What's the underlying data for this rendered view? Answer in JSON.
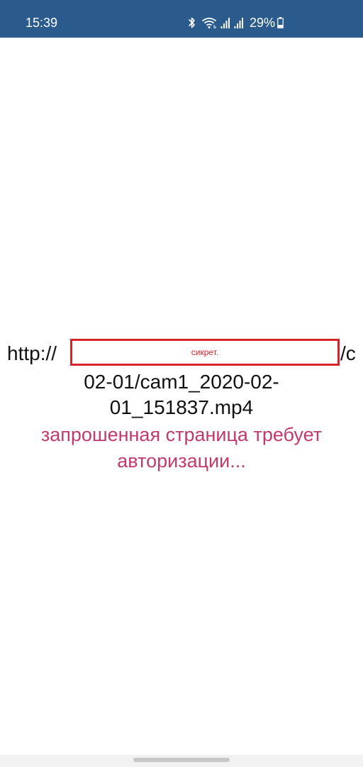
{
  "status_bar": {
    "time": "15:39",
    "battery": "29%",
    "icons": [
      "bluetooth-icon",
      "wifi-icon",
      "signal-icon",
      "signal-icon",
      "battery-icon"
    ],
    "background": "#2a5b8c"
  },
  "content": {
    "url_prefix": "http://",
    "redaction_label": "сикрет.",
    "url_suffix": "/c",
    "url_line2": "02-01/cam1_2020-02-",
    "url_line3": "01_151837.mp4",
    "auth_line1": "запрошенная страница требует",
    "auth_line2": "авторизации..."
  },
  "colors": {
    "message": "#c23a6c",
    "redaction_border": "#d7242b"
  }
}
